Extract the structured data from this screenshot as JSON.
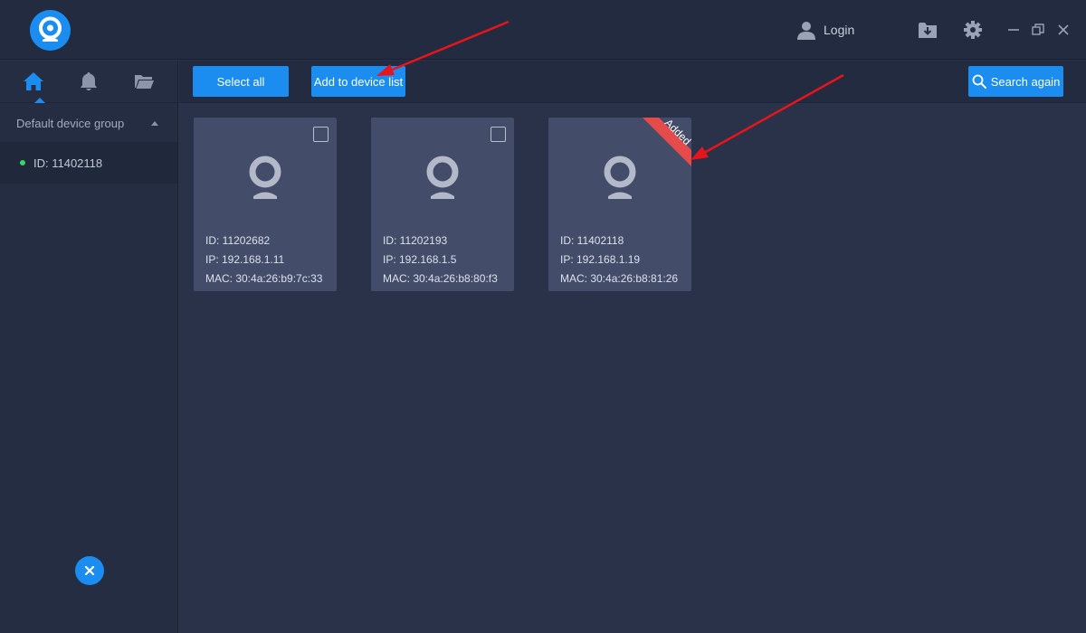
{
  "titlebar": {
    "login_label": "Login",
    "icons": [
      "app-logo-icon",
      "user-icon",
      "download-folder-icon",
      "gear-icon",
      "minimize-icon",
      "restore-icon",
      "close-icon"
    ]
  },
  "sidebar": {
    "tabs": [
      "home-icon",
      "bell-icon",
      "folder-icon"
    ],
    "active_tab": "home-icon",
    "group_label": "Default device group",
    "devices": [
      {
        "label": "ID: 11402118",
        "status": "online"
      }
    ]
  },
  "toolbar": {
    "select_all_label": "Select all",
    "add_label": "Add to device list",
    "search_label": "Search again"
  },
  "cards": [
    {
      "id": "ID: 11202682",
      "ip": "IP: 192.168.1.11",
      "mac": "MAC: 30:4a:26:b9:7c:33",
      "added": false
    },
    {
      "id": "ID: 11202193",
      "ip": "IP: 192.168.1.5",
      "mac": "MAC: 30:4a:26:b8:80:f3",
      "added": false
    },
    {
      "id": "ID: 11402118",
      "ip": "IP: 192.168.1.19",
      "mac": "MAC: 30:4a:26:b8:81:26",
      "added": true,
      "badge": "Added"
    }
  ],
  "colors": {
    "accent": "#1b8cf0",
    "background": "#293249",
    "card": "#434c69",
    "badge": "#e64b4b",
    "online": "#3ad66a",
    "annotation_arrow": "#e8141c"
  }
}
